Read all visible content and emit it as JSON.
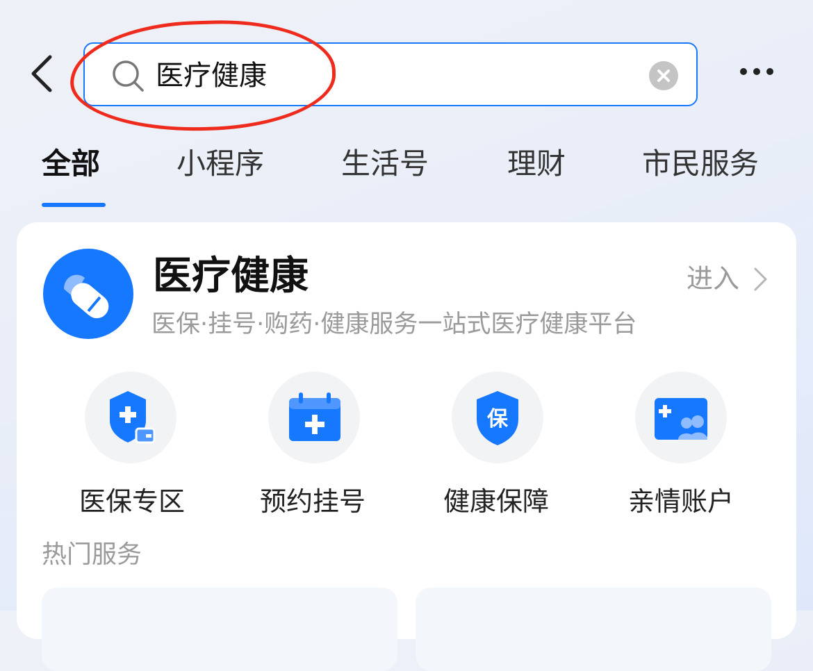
{
  "search": {
    "query": "医疗健康"
  },
  "tabs": [
    {
      "label": "全部"
    },
    {
      "label": "小程序"
    },
    {
      "label": "生活号"
    },
    {
      "label": "理财"
    },
    {
      "label": "市民服务"
    }
  ],
  "card": {
    "title": "医疗健康",
    "subtitle": "医保·挂号·购药·健康服务一站式医疗健康平台",
    "enter_label": "进入",
    "services": [
      {
        "label": "医保专区",
        "icon": "medical-insurance-icon"
      },
      {
        "label": "预约挂号",
        "icon": "calendar-plus-icon"
      },
      {
        "label": "健康保障",
        "icon": "shield-bao-icon"
      },
      {
        "label": "亲情账户",
        "icon": "family-account-icon"
      }
    ],
    "hot_title": "热门服务"
  },
  "colors": {
    "accent": "#1677ff",
    "annotation": "#ee2b1c"
  },
  "annotation": {
    "shape": "hand-drawn-circle",
    "target": "search-input"
  }
}
